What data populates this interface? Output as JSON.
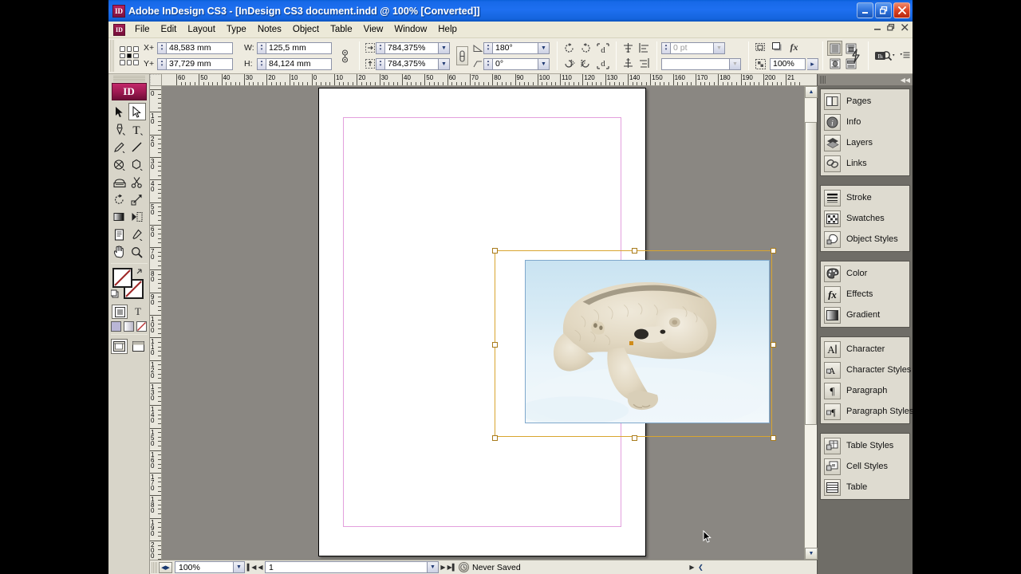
{
  "window": {
    "app_icon": "ID",
    "title": "Adobe InDesign CS3 - [InDesign CS3 document.indd @ 100% [Converted]]",
    "minimize": "–",
    "restore": "❐",
    "close": "✕",
    "doc_minimize": "–",
    "doc_restore": "❐",
    "doc_close": "✕"
  },
  "menubar": {
    "app_icon": "ID",
    "items": [
      {
        "label": "File"
      },
      {
        "label": "Edit"
      },
      {
        "label": "Layout"
      },
      {
        "label": "Type"
      },
      {
        "label": "Notes"
      },
      {
        "label": "Object"
      },
      {
        "label": "Table"
      },
      {
        "label": "View"
      },
      {
        "label": "Window"
      },
      {
        "label": "Help"
      }
    ]
  },
  "control_panel": {
    "x_label": "X+",
    "x_value": "48,583 mm",
    "y_label": "Y+",
    "y_value": "37,729 mm",
    "w_label": "W:",
    "w_value": "125,5 mm",
    "h_label": "H:",
    "h_value": "84,124 mm",
    "scale_x_value": "784,375%",
    "scale_y_value": "784,375%",
    "rotation_value": "180°",
    "shear_value": "0°",
    "stroke_weight_value": "0 pt",
    "stroke_type_value": "",
    "opacity_value": "100%",
    "constrain_icon": "link-icon",
    "transform_icons": [
      "rotate-ccw-icon",
      "rotate-cw-icon",
      "flip-corner-top-icon",
      "flip-horizontal-icon",
      "flip-vertical-icon",
      "flip-corner-bottom-icon"
    ],
    "drop_glyph": "d",
    "align_icons": [
      "distribute-top-icon",
      "align-left-icon",
      "distribute-bottom-icon",
      "align-right-icon"
    ],
    "effect_icons": [
      "frame-fitting-icon",
      "drop-shadow-icon",
      "fx-icon"
    ],
    "text_wrap_icons": [
      "wrap-none-icon",
      "wrap-bounding-icon",
      "wrap-shape-icon",
      "wrap-jump-icon"
    ],
    "fx_label": "fx",
    "lightning_icon": "quick-apply-icon",
    "bridge_icon": "go-to-bridge-icon",
    "menu_icon": "panel-menu-icon"
  },
  "toolbox": {
    "logo": "ID",
    "tools": [
      {
        "name": "selection-tool",
        "glyph": "↖"
      },
      {
        "name": "direct-selection-tool",
        "glyph": "↖",
        "selected": true
      },
      {
        "name": "pen-tool",
        "glyph": "pen"
      },
      {
        "name": "type-tool",
        "glyph": "T"
      },
      {
        "name": "pencil-tool",
        "glyph": "pencil"
      },
      {
        "name": "line-tool",
        "glyph": "line"
      },
      {
        "name": "frame-tool",
        "glyph": "ellipse-frame"
      },
      {
        "name": "shape-tool",
        "glyph": "polygon"
      },
      {
        "name": "free-transform-tool",
        "glyph": "transform"
      },
      {
        "name": "scissors-tool",
        "glyph": "scissors"
      },
      {
        "name": "rotate-tool",
        "glyph": "rotate"
      },
      {
        "name": "scale-tool",
        "glyph": "scale"
      },
      {
        "name": "gradient-swatch-tool",
        "glyph": "gradient"
      },
      {
        "name": "gradient-feather-tool",
        "glyph": "feather"
      },
      {
        "name": "note-tool",
        "glyph": "note"
      },
      {
        "name": "eyedropper-tool",
        "glyph": "eyedropper"
      },
      {
        "name": "hand-tool",
        "glyph": "hand"
      },
      {
        "name": "zoom-tool",
        "glyph": "magnifier"
      }
    ],
    "fill_label": "fill-swatch",
    "stroke_label": "stroke-swatch",
    "formatting_container_icon": "formatting-affects-container",
    "formatting_text_icon": "T",
    "swatch_icons": [
      "color-swatch",
      "gradient-swatch",
      "none-swatch"
    ],
    "mode_normal": "normal-view-mode",
    "mode_preview": "preview-mode"
  },
  "rulers": {
    "unit": "mm",
    "horizontal_labels": [
      "60",
      "50",
      "40",
      "30",
      "20",
      "10",
      "0",
      "10",
      "20",
      "30",
      "40",
      "50",
      "60",
      "70",
      "80",
      "90",
      "100",
      "110",
      "120",
      "130",
      "140",
      "150",
      "160",
      "170",
      "180",
      "190",
      "200",
      "21"
    ],
    "vertical_labels": [
      "0",
      "10",
      "20",
      "30",
      "40",
      "50",
      "60",
      "70",
      "80",
      "90",
      "100",
      "110",
      "120",
      "130",
      "140",
      "150",
      "160",
      "170",
      "180",
      "190",
      "200"
    ]
  },
  "canvas": {
    "page_name": "document-page",
    "margin_guide_color": "#e3a0dd",
    "frame_color": "#d9a52f",
    "image_name": "polar-bear-photo",
    "image_alt": "Polar bear lying in snow"
  },
  "statusbar": {
    "zoom_value": "100%",
    "page_value": "1",
    "save_status": "Never Saved",
    "first_page_glyph": "⏮",
    "prev_page_glyph": "◀",
    "next_page_glyph": "▶",
    "last_page_glyph": "⏭",
    "expand_glyph": "▶",
    "collapse_glyph": "❮"
  },
  "dock": {
    "collapse_glyph": "◀◀",
    "groups": [
      {
        "items": [
          {
            "label": "Pages",
            "icon": "pages-icon"
          },
          {
            "label": "Info",
            "icon": "info-icon"
          },
          {
            "label": "Layers",
            "icon": "layers-icon"
          },
          {
            "label": "Links",
            "icon": "links-icon"
          }
        ]
      },
      {
        "items": [
          {
            "label": "Stroke",
            "icon": "stroke-icon"
          },
          {
            "label": "Swatches",
            "icon": "swatches-icon"
          },
          {
            "label": "Object Styles",
            "icon": "object-styles-icon"
          }
        ]
      },
      {
        "items": [
          {
            "label": "Color",
            "icon": "color-icon"
          },
          {
            "label": "Effects",
            "icon": "effects-icon"
          },
          {
            "label": "Gradient",
            "icon": "gradient-icon"
          }
        ]
      },
      {
        "items": [
          {
            "label": "Character",
            "icon": "character-icon"
          },
          {
            "label": "Character Styles",
            "icon": "character-styles-icon"
          },
          {
            "label": "Paragraph",
            "icon": "paragraph-icon"
          },
          {
            "label": "Paragraph Styles",
            "icon": "paragraph-styles-icon"
          }
        ]
      },
      {
        "items": [
          {
            "label": "Table Styles",
            "icon": "table-styles-icon"
          },
          {
            "label": "Cell Styles",
            "icon": "cell-styles-icon"
          },
          {
            "label": "Table",
            "icon": "table-icon"
          }
        ]
      }
    ]
  }
}
